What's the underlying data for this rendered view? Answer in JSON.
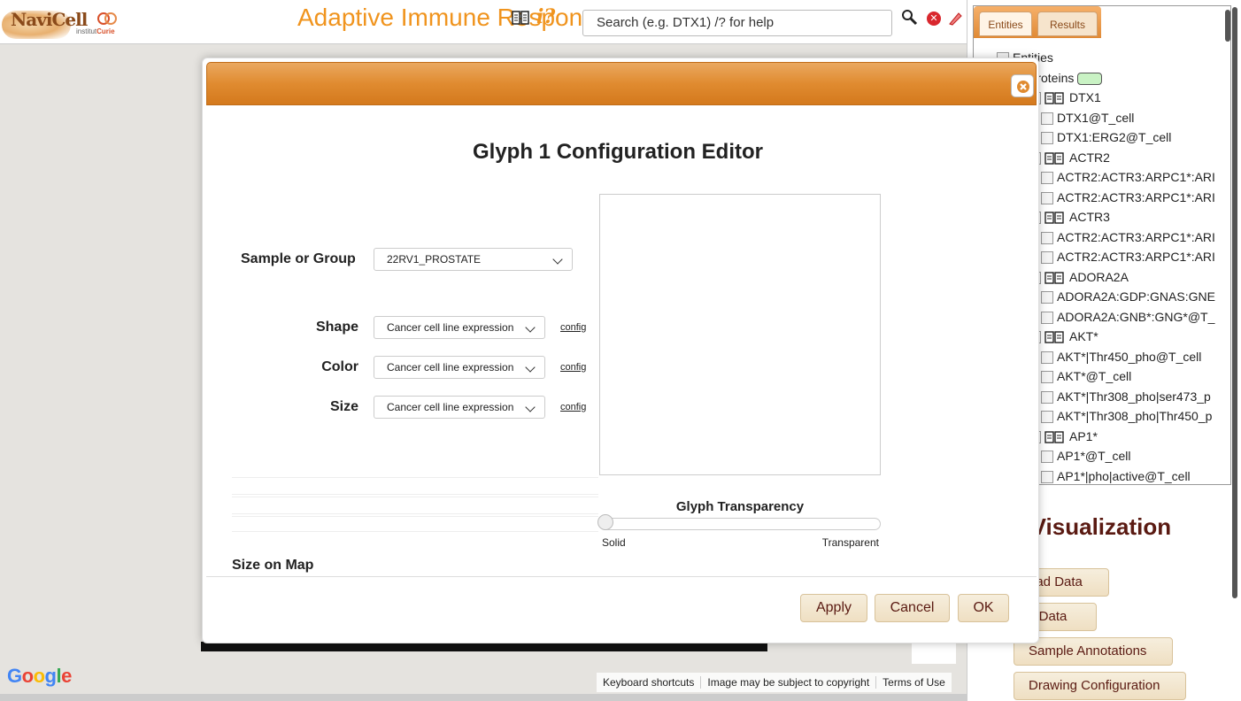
{
  "header": {
    "app_title": "Adaptive Immune Response",
    "navi_logo_text": "NaviCell",
    "curie_logo_prefix": "institut",
    "curie_logo_name": "Curie",
    "help_glyph": "i?",
    "search_placeholder": "Search (e.g.  DTX1)  /? for help"
  },
  "map": {
    "footer": [
      "Keyboard shortcuts",
      "Image may be subject to copyright",
      "Terms of Use"
    ]
  },
  "sidebar": {
    "tabs": [
      "Entities",
      "Results"
    ],
    "tree": [
      {
        "label": "Entities",
        "kind": "root"
      },
      {
        "label": "Proteins",
        "kind": "group"
      },
      {
        "label": "DTX1",
        "kind": "book"
      },
      {
        "label": "DTX1@T_cell",
        "kind": "leaf"
      },
      {
        "label": "DTX1:ERG2@T_cell",
        "kind": "leaf"
      },
      {
        "label": "ACTR2",
        "kind": "book"
      },
      {
        "label": "ACTR2:ACTR3:ARPC1*:ARI",
        "kind": "leaf"
      },
      {
        "label": "ACTR2:ACTR3:ARPC1*:ARI",
        "kind": "leaf"
      },
      {
        "label": "ACTR3",
        "kind": "book"
      },
      {
        "label": "ACTR2:ACTR3:ARPC1*:ARI",
        "kind": "leaf"
      },
      {
        "label": "ACTR2:ACTR3:ARPC1*:ARI",
        "kind": "leaf"
      },
      {
        "label": "ADORA2A",
        "kind": "book"
      },
      {
        "label": "ADORA2A:GDP:GNAS:GNE",
        "kind": "leaf"
      },
      {
        "label": "ADORA2A:GNB*:GNG*@T_",
        "kind": "leaf"
      },
      {
        "label": "AKT*",
        "kind": "book"
      },
      {
        "label": "AKT*|Thr450_pho@T_cell",
        "kind": "leaf"
      },
      {
        "label": "AKT*@T_cell",
        "kind": "leaf"
      },
      {
        "label": "AKT*|Thr308_pho|ser473_p",
        "kind": "leaf"
      },
      {
        "label": "AKT*|Thr308_pho|Thr450_p",
        "kind": "leaf"
      },
      {
        "label": "AP1*",
        "kind": "book"
      },
      {
        "label": "AP1*@T_cell",
        "kind": "leaf"
      },
      {
        "label": "AP1*|pho|active@T_cell",
        "kind": "leaf"
      }
    ],
    "viz_title": "a Visualization",
    "buttons": [
      "oad Data",
      "y Data",
      "Sample Annotations",
      "Drawing Configuration"
    ]
  },
  "modal": {
    "title": "Glyph 1 Configuration Editor",
    "sample_label": "Sample or Group",
    "sample_value": "22RV1_PROSTATE",
    "rows": [
      {
        "label": "Shape",
        "value": "Cancer cell line expression",
        "link": "config"
      },
      {
        "label": "Color",
        "value": "Cancer cell line expression",
        "link": "config"
      },
      {
        "label": "Size",
        "value": "Cancer cell line expression",
        "link": "config"
      }
    ],
    "transparency": {
      "label": "Glyph Transparency",
      "min_label": "Solid",
      "max_label": "Transparent",
      "value": 0
    },
    "size_on_map_label": "Size on Map",
    "buttons": {
      "apply": "Apply",
      "cancel": "Cancel",
      "ok": "OK"
    }
  },
  "colors": {
    "accent": "#f0941e",
    "dialog_header": "#e08b30",
    "button_text": "#5a1a12",
    "group_pill": "#c9f2c4"
  }
}
